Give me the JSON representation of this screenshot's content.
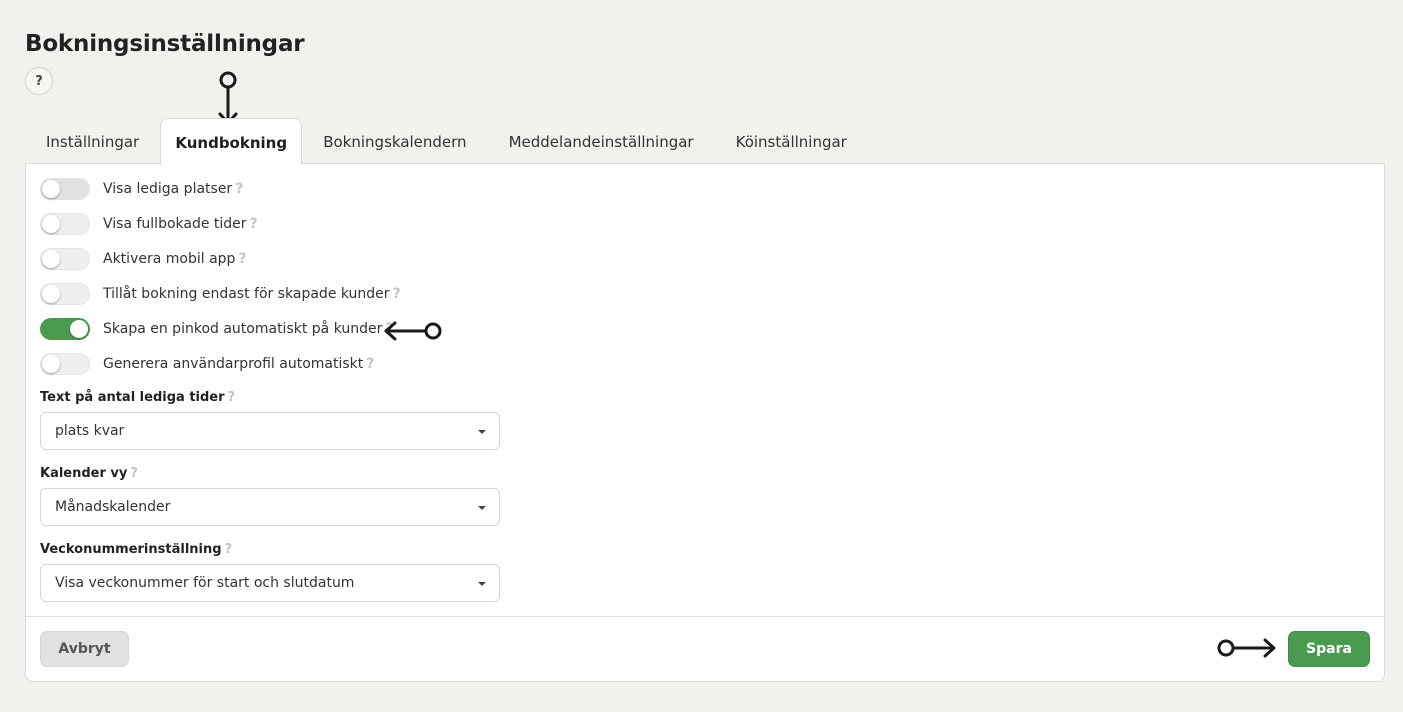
{
  "page": {
    "title": "Bokningsinställningar",
    "help_symbol": "?"
  },
  "tabs": [
    {
      "label": "Inställningar",
      "active": false
    },
    {
      "label": "Kundbokning",
      "active": true
    },
    {
      "label": "Bokningskalendern",
      "active": false
    },
    {
      "label": "Meddelandeinställningar",
      "active": false
    },
    {
      "label": "Köinställningar",
      "active": false
    }
  ],
  "toggles": [
    {
      "label": "Visa lediga platser",
      "on": false
    },
    {
      "label": "Visa fullbokade tider",
      "on": false
    },
    {
      "label": "Aktivera mobil app",
      "on": false
    },
    {
      "label": "Tillåt bokning endast för skapade kunder",
      "on": false
    },
    {
      "label": "Skapa en pinkod automatiskt på kunder",
      "on": true
    },
    {
      "label": "Generera användarprofil automatiskt",
      "on": false
    }
  ],
  "fields": [
    {
      "label": "Text på antal lediga tider",
      "value": "plats kvar"
    },
    {
      "label": "Kalender vy",
      "value": "Månadskalender"
    },
    {
      "label": "Veckonummerinställning",
      "value": "Visa veckonummer för start och slutdatum"
    }
  ],
  "help_mark": "?",
  "footer": {
    "cancel_label": "Avbryt",
    "save_label": "Spara"
  },
  "colors": {
    "accent_green": "#4a9b4f",
    "background": "#f2f1ed",
    "annotation_arrows": "#1a1a1a"
  }
}
